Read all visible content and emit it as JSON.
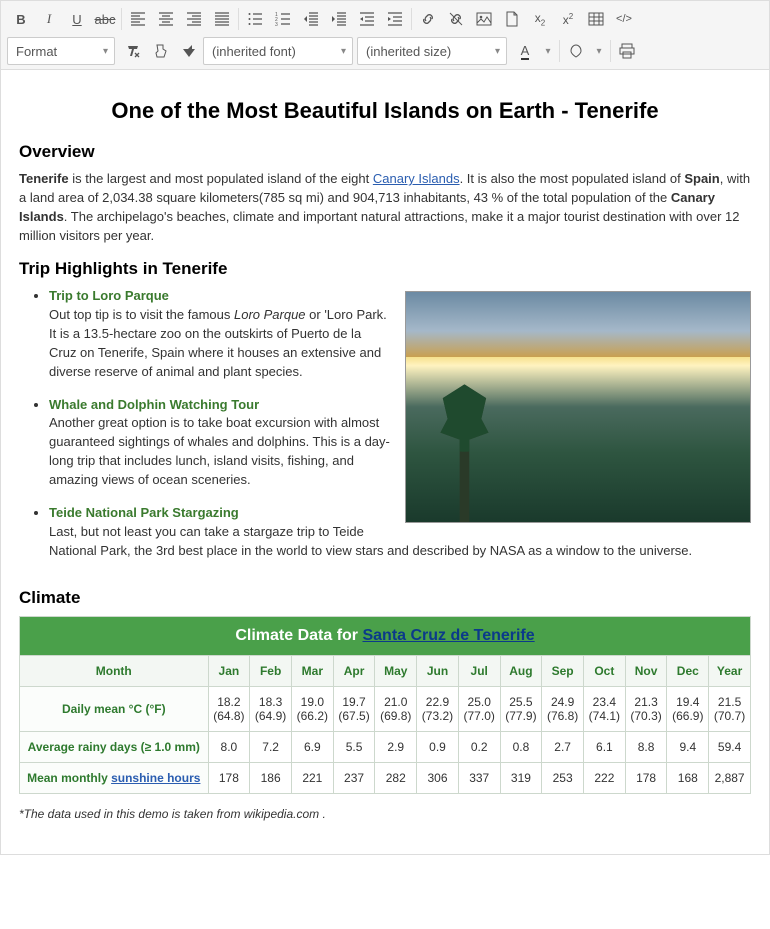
{
  "toolbar": {
    "format_label": "Format",
    "font_label": "(inherited font)",
    "size_label": "(inherited size)",
    "font_color_label": "A"
  },
  "title": "One of the Most Beautiful Islands on Earth - Tenerife",
  "overview": {
    "heading": "Overview",
    "bold1": "Tenerife",
    "t1": " is the largest and most populated island of the eight ",
    "link1": "Canary Islands",
    "t2": ". It is also the most populated island of ",
    "bold2": "Spain",
    "t3": ", with a land area of 2,034.38 square kilometers(785 sq mi) and 904,713 inhabitants, 43 % of the total population of the ",
    "bold3": "Canary Islands",
    "t4": ". The archipelago's beaches, climate and important natural attractions, make it a major tourist destination with over 12 million visitors per year."
  },
  "highlights": {
    "heading": "Trip Highlights in Tenerife",
    "items": [
      {
        "title": "Trip to Loro Parque",
        "pre": "Out top tip is to visit the famous ",
        "em": "Loro Parque",
        "post": " or 'Loro Park. It is a 13.5-hectare zoo on the outskirts of Puerto de la Cruz on Tenerife, Spain where it houses an extensive and diverse reserve of animal and plant species."
      },
      {
        "title": "Whale and Dolphin Watching Tour",
        "pre": "Another great option is to take boat excursion with almost guaranteed sightings of whales and dolphins. This is a day-long trip that includes lunch, island visits, fishing, and amazing views of ocean sceneries.",
        "em": "",
        "post": ""
      },
      {
        "title": "Teide National Park Stargazing",
        "pre": "Last, but not least you can take a stargaze trip to Teide National Park, the 3rd best place in the world to view stars and described by NASA as a window to the universe.",
        "em": "",
        "post": ""
      }
    ]
  },
  "climate": {
    "heading": "Climate",
    "caption_pre": "Climate Data for ",
    "caption_link": "Santa Cruz de Tenerife",
    "footnote": "*The data used in this demo is taken from wikipedia.com ."
  },
  "chart_data": {
    "type": "table",
    "title": "Climate Data for Santa Cruz de Tenerife",
    "columns": [
      "Month",
      "Jan",
      "Feb",
      "Mar",
      "Apr",
      "May",
      "Jun",
      "Jul",
      "Aug",
      "Sep",
      "Oct",
      "Nov",
      "Dec",
      "Year"
    ],
    "rows": [
      {
        "label": "Daily mean °C (°F)",
        "link": false,
        "top": [
          "18.2",
          "18.3",
          "19.0",
          "19.7",
          "21.0",
          "22.9",
          "25.0",
          "25.5",
          "24.9",
          "23.4",
          "21.3",
          "19.4",
          "21.5"
        ],
        "bot": [
          "(64.8)",
          "(64.9)",
          "(66.2)",
          "(67.5)",
          "(69.8)",
          "(73.2)",
          "(77.0)",
          "(77.9)",
          "(76.8)",
          "(74.1)",
          "(70.3)",
          "(66.9)",
          "(70.7)"
        ]
      },
      {
        "label": "Average rainy days (≥ 1.0 mm)",
        "link": false,
        "top": [
          "8.0",
          "7.2",
          "6.9",
          "5.5",
          "2.9",
          "0.9",
          "0.2",
          "0.8",
          "2.7",
          "6.1",
          "8.8",
          "9.4",
          "59.4"
        ],
        "bot": null
      },
      {
        "label_pre": "Mean monthly ",
        "label_link": "sunshine hours",
        "link": true,
        "top": [
          "178",
          "186",
          "221",
          "237",
          "282",
          "306",
          "337",
          "319",
          "253",
          "222",
          "178",
          "168",
          "2,887"
        ],
        "bot": null
      }
    ]
  }
}
